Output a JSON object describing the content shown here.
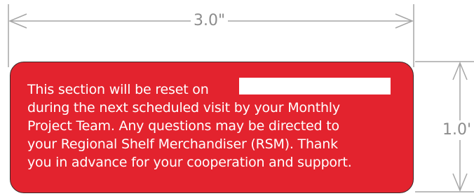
{
  "dimensions": {
    "width_label": "3.0\"",
    "height_label": "1.0'"
  },
  "label": {
    "lines": [
      "This section will be reset on",
      "during the next scheduled visit by your Monthly",
      "Project Team.  Any questions may be directed to",
      "your Regional Shelf Merchandiser  (RSM). Thank",
      "you in advance for your cooperation and support."
    ],
    "date_value": ""
  },
  "colors": {
    "label_background": "#e3232e",
    "label_text": "#ffffff",
    "dimension_lines": "#a6a6a6",
    "dimension_text": "#8c8c8c"
  }
}
